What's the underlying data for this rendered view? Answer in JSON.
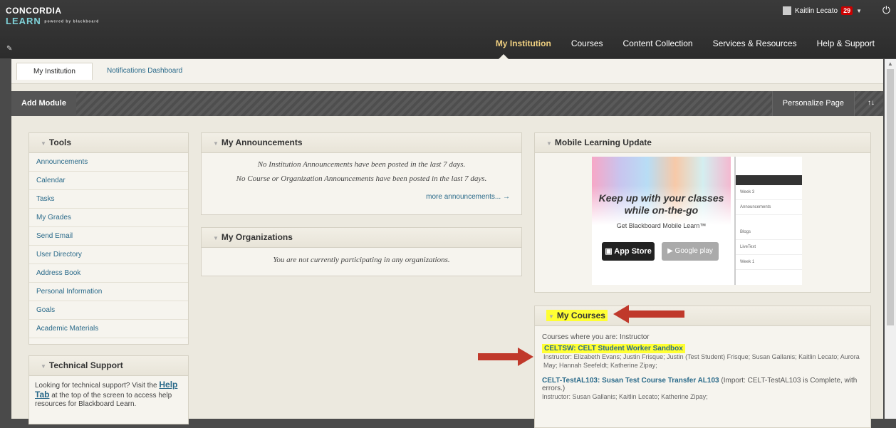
{
  "brand": {
    "line1": "CONCORDIA",
    "line2": "LEARN",
    "tagline": "powered by blackboard"
  },
  "user": {
    "name": "Kaitlin Lecato",
    "badge": "29"
  },
  "nav": {
    "items": [
      "My Institution",
      "Courses",
      "Content Collection",
      "Services & Resources",
      "Help & Support"
    ],
    "active": "My Institution"
  },
  "tabs": {
    "tab1": "My Institution",
    "tab2": "Notifications Dashboard"
  },
  "modbar": {
    "add": "Add Module",
    "personalize": "Personalize Page",
    "sort": "↑↓"
  },
  "tools": {
    "title": "Tools",
    "items": [
      "Announcements",
      "Calendar",
      "Tasks",
      "My Grades",
      "Send Email",
      "User Directory",
      "Address Book",
      "Personal Information",
      "Goals",
      "Academic Materials"
    ]
  },
  "support": {
    "title": "Technical Support",
    "text_pre": "Looking for technical support? Visit the",
    "link": "Help Tab",
    "text_post": "at the top of the screen to access help resources for Blackboard Learn."
  },
  "announcements": {
    "title": "My Announcements",
    "line1": "No Institution Announcements have been posted in the last 7 days.",
    "line2": "No Course or Organization Announcements have been posted in the last 7 days.",
    "more": "more announcements..."
  },
  "organizations": {
    "title": "My Organizations",
    "text": "You are not currently participating in any organizations."
  },
  "mobile": {
    "title": "Mobile Learning Update",
    "headline1": "Keep up with your classes",
    "headline2": "while on-the-go",
    "sub": "Get Blackboard Mobile Learn™",
    "store1": "App Store",
    "store2": "Google play",
    "phone_rows": [
      "Week 3",
      "Announcements",
      "Blogs",
      "LiveText",
      "Week 1"
    ]
  },
  "courses": {
    "title": "My Courses",
    "role": "Courses where you are: Instructor",
    "course1": {
      "name": "CELTSW: CELT Student Worker Sandbox",
      "instructors": "Instructor: Elizabeth Evans; Justin Frisque; Justin (Test Student) Frisque; Susan Gallanis; Kaitlin Lecato; Aurora May; Hannah Seefeldt; Katherine Zipay;"
    },
    "course2": {
      "name": "CELT-TestAL103: Susan Test Course Transfer AL103",
      "note": "(Import: CELT-TestAL103 is Complete, with errors.)",
      "instructors": "Instructor: Susan Gallanis; Kaitlin Lecato; Katherine Zipay;"
    }
  }
}
